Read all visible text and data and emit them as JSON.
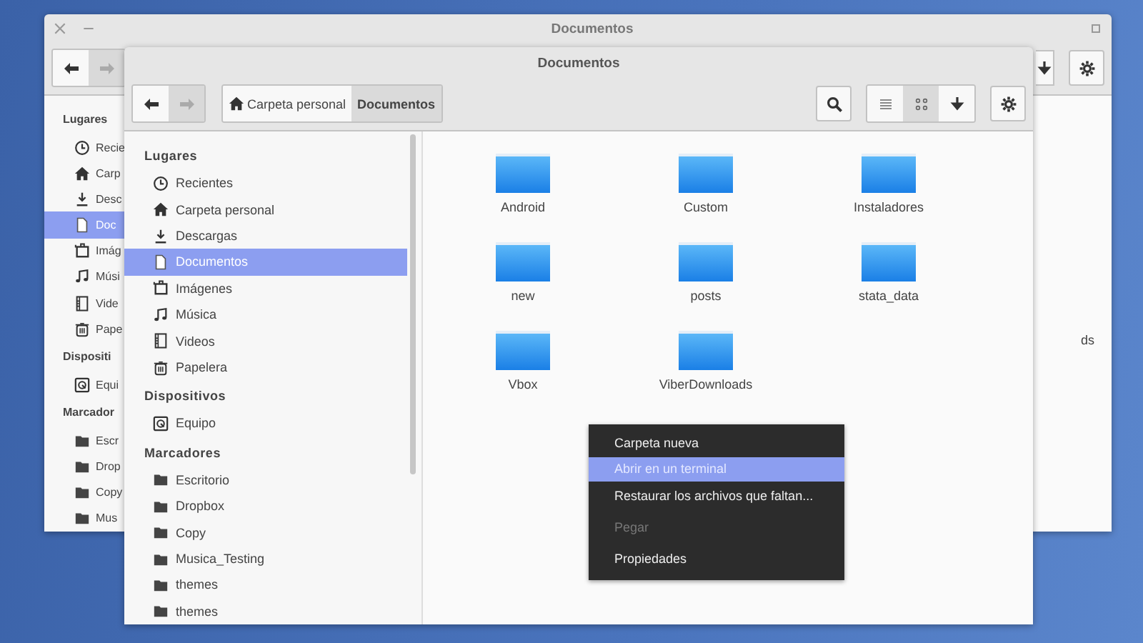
{
  "back_window": {
    "title": "Documentos",
    "toolbar": {
      "nav": [
        {
          "kind": "back",
          "disabled": false
        },
        {
          "kind": "forward",
          "disabled": true
        }
      ]
    },
    "sidebar": {
      "sections": [
        {
          "heading": "Lugares",
          "items": [
            {
              "label": "Recie",
              "kind": "recent",
              "selected": false
            },
            {
              "label": "Carp",
              "kind": "home",
              "selected": false
            },
            {
              "label": "Desc",
              "kind": "download",
              "selected": false
            },
            {
              "label": "Doc",
              "kind": "document",
              "selected": true
            },
            {
              "label": "Imág",
              "kind": "images",
              "selected": false
            },
            {
              "label": "Músi",
              "kind": "music",
              "selected": false
            },
            {
              "label": "Vide",
              "kind": "videos",
              "selected": false
            },
            {
              "label": "Pape",
              "kind": "trash",
              "selected": false
            }
          ]
        },
        {
          "heading": "Dispositi",
          "items": [
            {
              "label": "Equi",
              "kind": "computer",
              "selected": false
            }
          ]
        },
        {
          "heading": "Marcador",
          "items": [
            {
              "label": "Escr",
              "kind": "bookmark",
              "selected": false
            },
            {
              "label": "Drop",
              "kind": "bookmark",
              "selected": false
            },
            {
              "label": "Copy",
              "kind": "bookmark",
              "selected": false
            },
            {
              "label": "Mus",
              "kind": "bookmark",
              "selected": false
            }
          ]
        }
      ]
    },
    "file_label": "ds"
  },
  "front_window": {
    "title": "Documentos",
    "toolbar": {
      "nav": [
        {
          "kind": "back",
          "disabled": false
        },
        {
          "kind": "forward",
          "disabled": true
        }
      ],
      "path": [
        {
          "label": "Carpeta personal",
          "kind": "home",
          "selected": false
        },
        {
          "label": "Documentos",
          "kind": "folder",
          "selected": true
        }
      ],
      "view_buttons": [
        {
          "kind": "list",
          "selected": false
        },
        {
          "kind": "grid",
          "selected": true
        },
        {
          "kind": "sort",
          "selected": false
        }
      ]
    },
    "sidebar": {
      "sections": [
        {
          "heading": "Lugares",
          "items": [
            {
              "label": "Recientes",
              "kind": "recent",
              "selected": false
            },
            {
              "label": "Carpeta personal",
              "kind": "home",
              "selected": false
            },
            {
              "label": "Descargas",
              "kind": "download",
              "selected": false
            },
            {
              "label": "Documentos",
              "kind": "document",
              "selected": true
            },
            {
              "label": "Imágenes",
              "kind": "images",
              "selected": false
            },
            {
              "label": "Música",
              "kind": "music",
              "selected": false
            },
            {
              "label": "Videos",
              "kind": "videos",
              "selected": false
            },
            {
              "label": "Papelera",
              "kind": "trash",
              "selected": false
            }
          ]
        },
        {
          "heading": "Dispositivos",
          "items": [
            {
              "label": "Equipo",
              "kind": "computer",
              "selected": false
            }
          ]
        },
        {
          "heading": "Marcadores",
          "items": [
            {
              "label": "Escritorio",
              "kind": "bookmark",
              "selected": false
            },
            {
              "label": "Dropbox",
              "kind": "bookmark",
              "selected": false
            },
            {
              "label": "Copy",
              "kind": "bookmark",
              "selected": false
            },
            {
              "label": "Musica_Testing",
              "kind": "bookmark",
              "selected": false
            },
            {
              "label": "themes",
              "kind": "bookmark",
              "selected": false
            },
            {
              "label": "themes",
              "kind": "bookmark",
              "selected": false
            }
          ]
        }
      ]
    },
    "folders": [
      {
        "name": "Android"
      },
      {
        "name": "Custom"
      },
      {
        "name": "Instaladores"
      },
      {
        "name": "new"
      },
      {
        "name": "posts"
      },
      {
        "name": "stata_data"
      },
      {
        "name": "Vbox"
      },
      {
        "name": "ViberDownloads"
      }
    ],
    "context_menu": [
      {
        "label": "Carpeta nueva",
        "selected": false,
        "disabled": false
      },
      {
        "label": "Abrir en un terminal",
        "selected": true,
        "disabled": false
      },
      {
        "label": "Restaurar los archivos que faltan...",
        "selected": false,
        "disabled": false
      },
      {
        "label": "Pegar",
        "selected": false,
        "disabled": true
      },
      {
        "label": "Propiedades",
        "selected": false,
        "disabled": false
      }
    ]
  }
}
